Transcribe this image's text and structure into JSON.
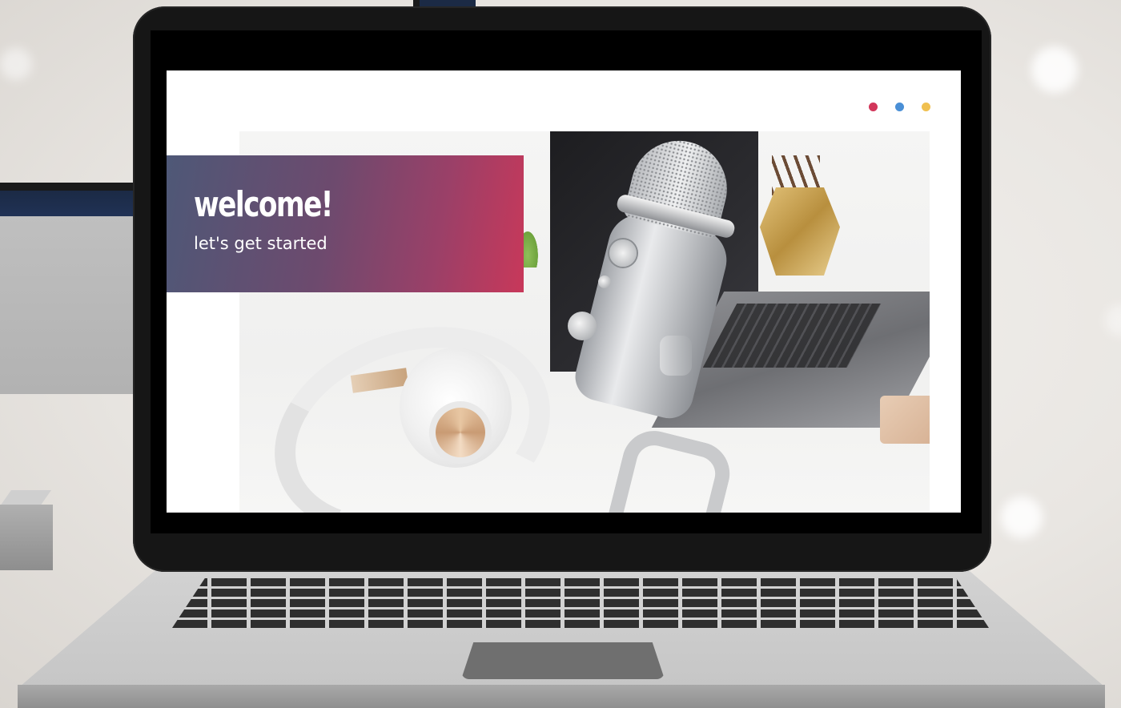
{
  "screen": {
    "banner": {
      "title": "welcome!",
      "subtitle": "let's get started"
    },
    "dots": [
      {
        "name": "red-dot",
        "color": "#d2365a"
      },
      {
        "name": "blue-dot",
        "color": "#4a8fd6"
      },
      {
        "name": "yellow-dot",
        "color": "#f0c050"
      }
    ]
  },
  "colors": {
    "banner_gradient_start": "#4e5877",
    "banner_gradient_end": "#c8385a",
    "laptop_frame": "#161616",
    "laptop_base": "#d2d2d2"
  }
}
